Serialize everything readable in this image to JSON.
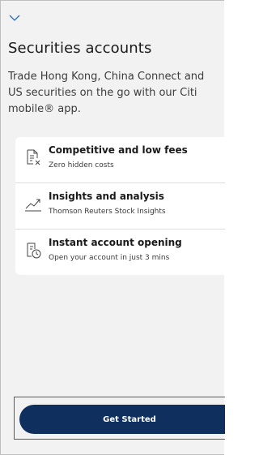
{
  "header": {
    "collapse_icon": "chevron-down-icon"
  },
  "page": {
    "title": "Securities accounts",
    "description": "Trade Hong Kong, China Connect and US securities on the go with our Citi mobile® app."
  },
  "features": [
    {
      "icon": "document-fee-icon",
      "title": "Competitive and low fees",
      "subtitle": "Zero hidden costs"
    },
    {
      "icon": "trend-chart-icon",
      "title": "Insights and analysis",
      "subtitle": "Thomson Reuters Stock Insights"
    },
    {
      "icon": "clock-document-icon",
      "title": "Instant account opening",
      "subtitle": "Open your account in just 3 mins"
    }
  ],
  "cta": {
    "label": "Get Started"
  },
  "colors": {
    "background": "#f2f2f2",
    "card": "#ffffff",
    "button": "#0f2f5e",
    "highlight_border": "#e0202a",
    "accent_icon": "#2a6ebb"
  }
}
